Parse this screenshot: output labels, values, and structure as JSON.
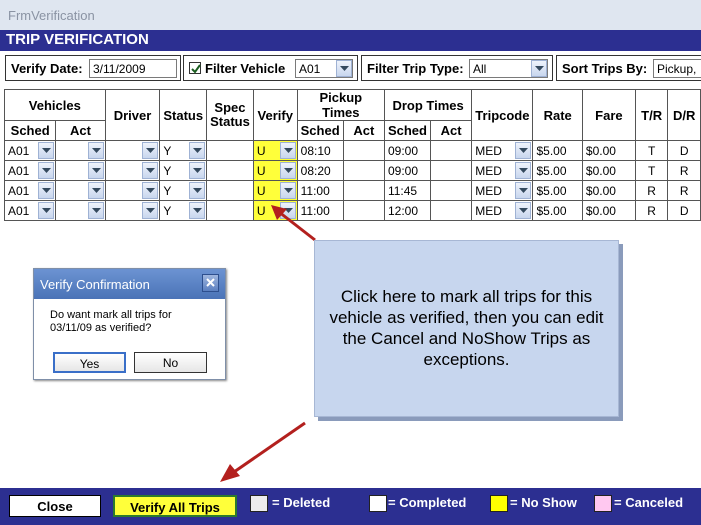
{
  "window": {
    "title": "FrmVerification"
  },
  "header": {
    "title": "TRIP VERIFICATION"
  },
  "filters": {
    "verify_date_label": "Verify Date:",
    "verify_date_value": "3/11/2009",
    "filter_vehicle_label": "Filter Vehicle",
    "filter_vehicle_checked": true,
    "filter_vehicle_value": "A01",
    "filter_trip_type_label": "Filter Trip Type:",
    "filter_trip_type_value": "All",
    "sort_trips_label": "Sort Trips By:",
    "sort_trips_value": "Pickup,"
  },
  "grid": {
    "group_headers": {
      "vehicles": "Vehicles",
      "driver": "Driver",
      "status": "Status",
      "spec_status": "Spec Status",
      "verify": "Verify",
      "pickup_times": "Pickup Times",
      "drop_times": "Drop Times",
      "tripcode": "Tripcode",
      "rate": "Rate",
      "fare": "Fare",
      "tr": "T/R",
      "dr": "D/R"
    },
    "sub_headers": {
      "sched": "Sched",
      "act": "Act"
    },
    "rows": [
      {
        "vehicle": "A01",
        "status": "Y",
        "verify": "U",
        "pickup": "08:10",
        "drop": "09:00",
        "tripcode": "MED",
        "rate": "$5.00",
        "fare": "$0.00",
        "tr": "T",
        "dr": "D"
      },
      {
        "vehicle": "A01",
        "status": "Y",
        "verify": "U",
        "pickup": "08:20",
        "drop": "09:00",
        "tripcode": "MED",
        "rate": "$5.00",
        "fare": "$0.00",
        "tr": "T",
        "dr": "R"
      },
      {
        "vehicle": "A01",
        "status": "Y",
        "verify": "U",
        "pickup": "11:00",
        "drop": "11:45",
        "tripcode": "MED",
        "rate": "$5.00",
        "fare": "$0.00",
        "tr": "R",
        "dr": "R"
      },
      {
        "vehicle": "A01",
        "status": "Y",
        "verify": "U",
        "pickup": "11:00",
        "drop": "12:00",
        "tripcode": "MED",
        "rate": "$5.00",
        "fare": "$0.00",
        "tr": "R",
        "dr": "D"
      }
    ]
  },
  "callout": {
    "text": "Click here to mark all trips for this vehicle as verified, then you can edit the Cancel and NoShow Trips as exceptions."
  },
  "dialog": {
    "title": "Verify Confirmation",
    "message": "Do want mark all trips for 03/11/09 as verified?",
    "yes_label": "Yes",
    "no_label": "No"
  },
  "footer": {
    "close_label": "Close",
    "verify_all_label": "Verify All Trips",
    "legend": [
      {
        "label": "= Deleted",
        "color": "#ececec"
      },
      {
        "label": "= Completed",
        "color": "#ffffff"
      },
      {
        "label": "= No Show",
        "color": "#ffff00"
      },
      {
        "label": "= Canceled",
        "color": "#ffc8f0"
      }
    ]
  },
  "colors": {
    "header_bg": "#2c2f91",
    "verify_highlight": "#ffff3a",
    "callout_bg": "#c7d6ee",
    "arrow": "#b3201e"
  }
}
